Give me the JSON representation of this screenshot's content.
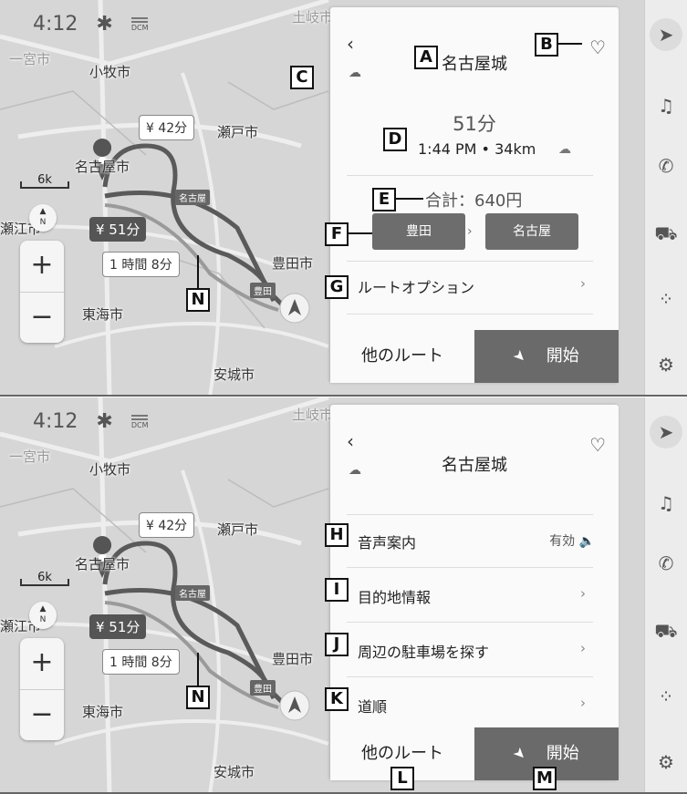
{
  "status": {
    "time": "4:12",
    "bluetooth_icon": "bluetooth-icon",
    "signal_label": "DCM"
  },
  "map": {
    "scale": "6k",
    "compass": "N",
    "zoom_in": "+",
    "zoom_out": "−",
    "cities": {
      "toki": "土岐市",
      "ichinomiya": "一宮市",
      "komaki": "小牧市",
      "seto": "瀬戸市",
      "nagoya": "名古屋市",
      "toyota": "豊田市",
      "tokai": "東海市",
      "anjo": "安城市",
      "edge_left": "瀬江市"
    },
    "route_bubbles": {
      "route1": "¥ 42分",
      "route2": "¥ 51分",
      "route3": "1 時間 8分"
    },
    "road_signs": {
      "nagoya": "名古屋",
      "toyota": "豊田"
    }
  },
  "panel_top": {
    "destination": "名古屋城",
    "duration": "51分",
    "eta": "1:44 PM • 34km",
    "toll_total": "合計：640円",
    "toll_from": "豊田",
    "toll_to": "名古屋",
    "route_option": "ルートオプション",
    "other_routes": "他のルート",
    "start": "開始"
  },
  "panel_bottom": {
    "destination": "名古屋城",
    "voice_guidance": "音声案内",
    "voice_status": "有効",
    "destination_info": "目的地情報",
    "find_parking": "周辺の駐車場を探す",
    "directions": "道順",
    "other_routes": "他のルート",
    "start": "開始"
  },
  "callouts": {
    "A": "A",
    "B": "B",
    "C": "C",
    "D": "D",
    "E": "E",
    "F": "F",
    "G": "G",
    "H": "H",
    "I": "I",
    "J": "J",
    "K": "K",
    "L": "L",
    "M": "M",
    "N": "N"
  },
  "colors": {
    "panel": "#fafafa",
    "button_dark": "#6a6a6a",
    "route_dark": "#5a5a5a",
    "route_light": "#999999"
  }
}
